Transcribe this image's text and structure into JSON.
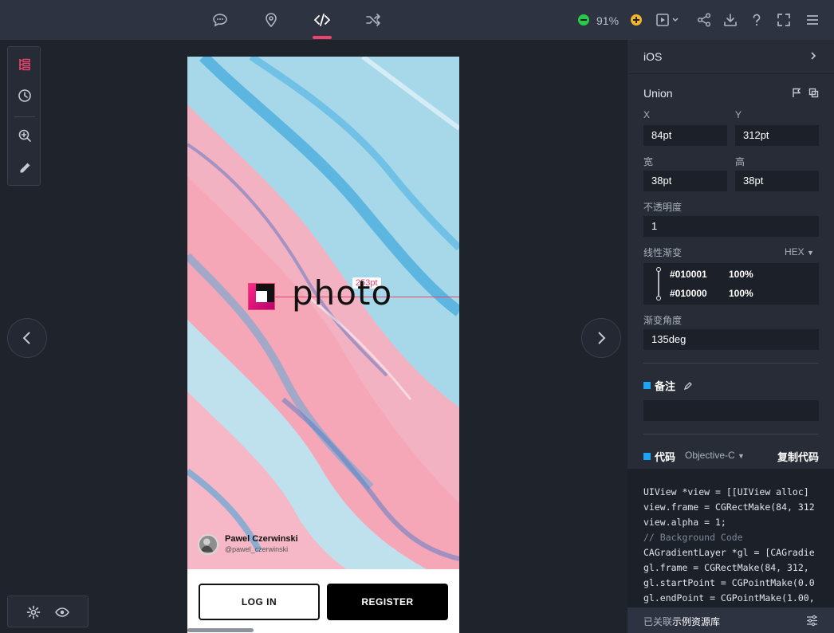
{
  "toolbar": {
    "icons": [
      "comment-icon",
      "location-pin-icon",
      "code-icon",
      "shuffle-icon"
    ],
    "zoom_level": "91%",
    "right_icons": [
      "play-icon",
      "share-icon",
      "download-icon",
      "help-icon",
      "fullscreen-icon",
      "menu-icon"
    ]
  },
  "left_tools": [
    "layers-icon",
    "history-icon",
    "zoom-icon",
    "eyedropper-icon"
  ],
  "bottom_tools": [
    "settings-icon",
    "eye-icon"
  ],
  "artboard": {
    "logo_text": "photo",
    "measure_label": "253pt",
    "credit_name": "Pawel Czerwinski",
    "credit_handle": "@pawel_czerwinski",
    "login_label": "LOG IN",
    "register_label": "REGISTER"
  },
  "inspector": {
    "platform": "iOS",
    "layer_name": "Union",
    "x_label": "X",
    "x_value": "84pt",
    "y_label": "Y",
    "y_value": "312pt",
    "width_label": "宽",
    "width_value": "38pt",
    "height_label": "高",
    "height_value": "38pt",
    "opacity_label": "不透明度",
    "opacity_value": "1",
    "gradient_label": "线性渐变",
    "color_format": "HEX",
    "gradient_stops": [
      {
        "color": "#010001",
        "opacity": "100%"
      },
      {
        "color": "#010000",
        "opacity": "100%"
      }
    ],
    "angle_label": "渐变角度",
    "angle_value": "135deg",
    "note_label": "备注",
    "code_label": "代码",
    "code_language": "Objective-C",
    "copy_code_label": "复制代码",
    "footer_prefix": "已关联",
    "footer_link": "示例资源库"
  },
  "code_lines": [
    "UIView *view = [[UIView alloc]",
    "view.frame = CGRectMake(84, 312",
    "view.alpha = 1;",
    "// Background Code",
    "CAGradientLayer *gl = [CAGradie",
    "gl.frame = CGRectMake(84, 312,",
    "gl.startPoint = CGPointMake(0.0",
    "gl.endPoint = CGPointMake(1.00,"
  ],
  "colors": {
    "accent": "#e9456e",
    "section_marker": "#1aa5f5",
    "zoom_out": "#2ac84a",
    "zoom_in": "#f5b625"
  }
}
